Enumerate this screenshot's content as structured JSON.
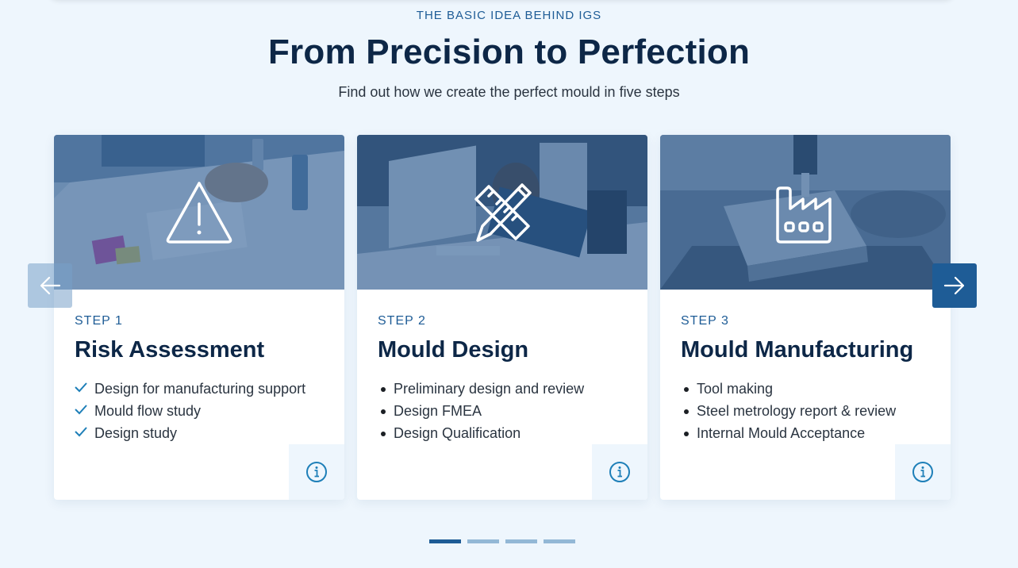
{
  "section": {
    "eyebrow": "THE BASIC IDEA BEHIND IGS",
    "headline": "From Precision to Perfection",
    "subline": "Find out how we create the perfect mould in five steps"
  },
  "cards": [
    {
      "step": "STEP 1",
      "title": "Risk Assessment",
      "icon": "warning-triangle-icon",
      "list_style": "check",
      "items": [
        "Design for manufacturing support",
        "Mould flow study",
        "Design study"
      ]
    },
    {
      "step": "STEP 2",
      "title": "Mould Design",
      "icon": "pencil-ruler-icon",
      "list_style": "bullet",
      "items": [
        "Preliminary design and review",
        "Design FMEA",
        "Design Qualification"
      ]
    },
    {
      "step": "STEP 3",
      "title": "Mould Manufacturing",
      "icon": "factory-icon",
      "list_style": "bullet",
      "items": [
        "Tool making",
        "Steel metrology report & review",
        "Internal Mould Acceptance"
      ]
    }
  ],
  "carousel": {
    "prev_icon": "arrow-left-icon",
    "next_icon": "arrow-right-icon",
    "pages": 4,
    "active_page": 1
  },
  "colors": {
    "background": "#eef6fd",
    "accent": "#1e5c96",
    "heading": "#0d2747"
  }
}
